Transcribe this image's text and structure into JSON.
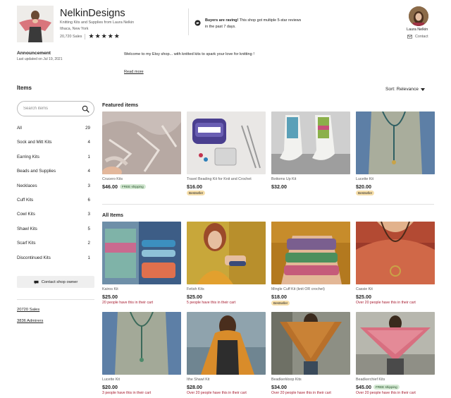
{
  "shop": {
    "name": "NelkinDesigns",
    "tagline": "Knitting Kits and Supplies from Laura Nelkin",
    "location": "Ithaca, New York",
    "sales": "20,720 Sales",
    "rating_stars": 5
  },
  "raving": {
    "bold": "Buyers are raving!",
    "text": " This shop got multiple 5-star reviews in the past 7 days."
  },
  "owner": {
    "name": "Laura Nelkin",
    "contact_label": "Contact"
  },
  "announcement": {
    "title": "Announcement",
    "updated": "Last updated on Jul 19, 2021",
    "body": "Welcome to my Etsy shop... with knitted kits to spark your love for knitting !",
    "read_more": "Read more"
  },
  "sidebar": {
    "heading": "Items",
    "search_placeholder": "Search items",
    "sections": [
      {
        "label": "All",
        "count": "29"
      },
      {
        "label": "Sock and Mitt Kits",
        "count": "4"
      },
      {
        "label": "Earring Kits",
        "count": "1"
      },
      {
        "label": "Beads and Supplies",
        "count": "4"
      },
      {
        "label": "Necklaces",
        "count": "3"
      },
      {
        "label": "Cuff Kits",
        "count": "6"
      },
      {
        "label": "Cowl Kits",
        "count": "3"
      },
      {
        "label": "Shawl Kits",
        "count": "5"
      },
      {
        "label": "Scarf Kits",
        "count": "2"
      },
      {
        "label": "Discontinued Kits",
        "count": "1"
      }
    ],
    "contact_owner": "Contact shop owner",
    "sales_link": "20720 Sales",
    "admirers_link": "3836 Admirers"
  },
  "main": {
    "sort_label": "Sort: Relevance",
    "featured_title": "Featured items",
    "all_title": "All Items",
    "featured": [
      {
        "title": "Crucero Kits",
        "price": "$46.00",
        "shipping": "FREE shipping"
      },
      {
        "title": "Travel Beading Kit for Knit and Crochet",
        "price": "$16.00",
        "badge": "Bestseller"
      },
      {
        "title": "Bottoms Up Kit",
        "price": "$32.00"
      },
      {
        "title": "Lucette Kit",
        "price": "$20.00",
        "badge": "Bestseller"
      }
    ],
    "all_items": [
      {
        "title": "Kairos Kit",
        "price": "$25.00",
        "note": "20 people have this in their cart"
      },
      {
        "title": "Fetish Kits",
        "price": "$25.00",
        "note": "5 people have this in their cart"
      },
      {
        "title": "Mingle Cuff Kit (knit OR crochet)",
        "price": "$18.00",
        "badge": "Bestseller"
      },
      {
        "title": "Cassie Kit",
        "price": "$25.00",
        "note": "Over 20 people have this in their cart"
      },
      {
        "title": "Lucette Kit",
        "price": "$20.00",
        "note": "3 people have this in their cart"
      },
      {
        "title": "Ithe Shawl Kit",
        "price": "$28.00",
        "note": "Over 20 people have this in their cart"
      },
      {
        "title": "Beadkerkloop Kits",
        "price": "$34.00",
        "note": "Over 20 people have this in their cart"
      },
      {
        "title": "Beadkerchief Kits",
        "price": "$45.00",
        "shipping": "FREE shipping",
        "note": "Over 20 people have this in their cart"
      }
    ]
  },
  "colors": {
    "text": "#222222",
    "muted": "#595959",
    "cart_note": "#a61a2e",
    "free_shipping_bg": "#d4e9d3",
    "bestseller_bg": "#f7dfaa",
    "button_bg": "#efefef"
  }
}
